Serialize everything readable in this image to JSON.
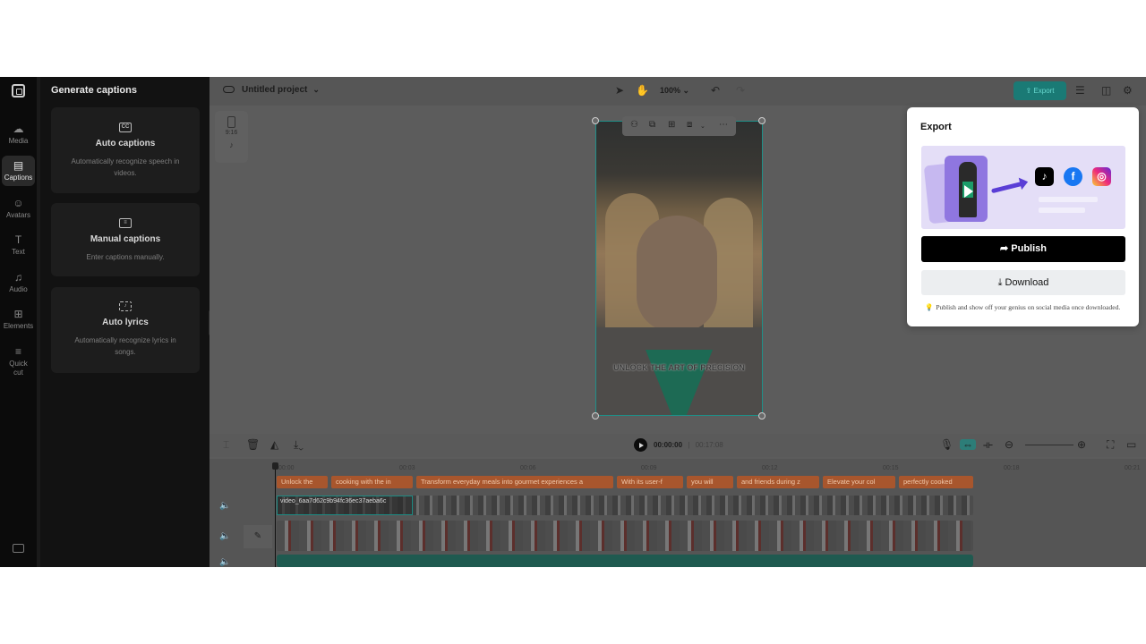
{
  "sidebar": {
    "items": [
      {
        "label": "Media",
        "icon": "media-icon"
      },
      {
        "label": "Captions",
        "icon": "captions-icon"
      },
      {
        "label": "Avatars",
        "icon": "avatars-icon"
      },
      {
        "label": "Text",
        "icon": "text-icon"
      },
      {
        "label": "Audio",
        "icon": "audio-icon"
      },
      {
        "label": "Elements",
        "icon": "elements-icon"
      },
      {
        "label": "Quick cut",
        "icon": "quick-cut-icon"
      }
    ],
    "active": "Captions"
  },
  "captions_panel": {
    "title": "Generate captions",
    "cards": [
      {
        "title": "Auto captions",
        "description": "Automatically recognize speech in videos.",
        "icon": "CC"
      },
      {
        "title": "Manual captions",
        "description": "Enter captions manually.",
        "icon": "subtitles-icon"
      },
      {
        "title": "Auto lyrics",
        "description": "Automatically recognize lyrics in songs.",
        "icon": "lyrics-icon"
      }
    ]
  },
  "topbar": {
    "project_name": "Untitled project",
    "zoom": "100%",
    "export_label": "Export"
  },
  "canvas": {
    "aspect_ratio": "9:16",
    "subtitle": "UNLOCK THE ART OF PRECISION"
  },
  "timeline": {
    "current_time": "00:00:00",
    "separator": "|",
    "duration": "00:17:08",
    "ruler": [
      "00:00",
      "00:03",
      "00:06",
      "00:09",
      "00:12",
      "00:15",
      "00:18",
      "00:21"
    ],
    "caption_clips": [
      "Unlock the",
      "cooking with the in",
      "Transform everyday meals into gourmet experiences a",
      "With its user-f",
      "you will",
      "and friends during z",
      "Elevate your col",
      "perfectly cooked"
    ],
    "video_clip_label": "video_6aa7d62c9b94fc36ec37aeba6c"
  },
  "export_popover": {
    "title": "Export",
    "publish_label": "Publish",
    "download_label": "Download",
    "note": "Publish and show off your genius on social media once downloaded.",
    "social": [
      "tiktok",
      "facebook",
      "instagram"
    ]
  },
  "colors": {
    "accent": "#1a7a75",
    "caption_clip": "#a8562d",
    "publish_button": "#000000"
  }
}
